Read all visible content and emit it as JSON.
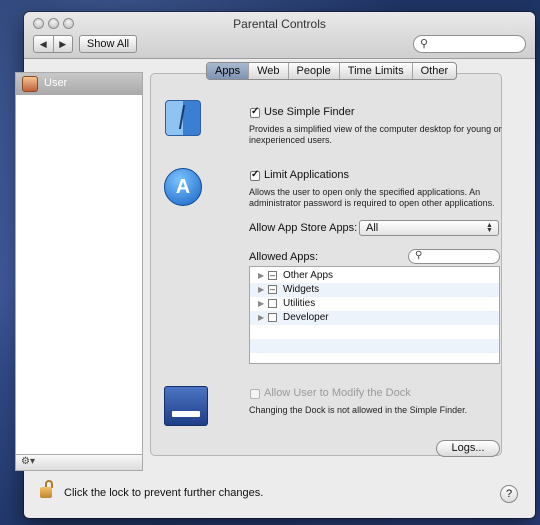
{
  "window": {
    "title": "Parental Controls"
  },
  "toolbar": {
    "back_icon": "◀",
    "forward_icon": "▶",
    "show_all_label": "Show All",
    "search_placeholder": "",
    "search_icon": "🔍"
  },
  "sidebar": {
    "users": [
      {
        "label": "User",
        "selected": true
      }
    ],
    "gear_label": "⚙▾"
  },
  "tabs": [
    {
      "label": "Apps",
      "active": true
    },
    {
      "label": "Web",
      "active": false
    },
    {
      "label": "People",
      "active": false
    },
    {
      "label": "Time Limits",
      "active": false
    },
    {
      "label": "Other",
      "active": false
    }
  ],
  "apps": {
    "simple_finder": {
      "label": "Use Simple Finder",
      "checked": true,
      "description": "Provides a simplified view of the computer desktop for young or inexperienced users."
    },
    "limit_apps": {
      "label": "Limit Applications",
      "checked": true,
      "description": "Allows the user to open only the specified applications. An administrator password is required to open other applications."
    },
    "app_store_label": "Allow App Store Apps:",
    "app_store_value": "All",
    "allowed_apps_label": "Allowed Apps:",
    "allowed_apps": [
      {
        "label": "Other Apps",
        "state": "mixed"
      },
      {
        "label": "Widgets",
        "state": "mixed"
      },
      {
        "label": "Utilities",
        "state": "off"
      },
      {
        "label": "Developer",
        "state": "off"
      }
    ],
    "dock": {
      "label": "Allow User to Modify the Dock",
      "checked": false,
      "enabled": false,
      "description": "Changing the Dock is not allowed in the Simple Finder."
    },
    "logs_label": "Logs..."
  },
  "footer": {
    "lock_text": "Click the lock to prevent further changes.",
    "help_label": "?"
  },
  "colors": {
    "selection": "#a9a9a9",
    "tab_active": "#8a9cbb",
    "desktop": "#2b3f6e"
  }
}
